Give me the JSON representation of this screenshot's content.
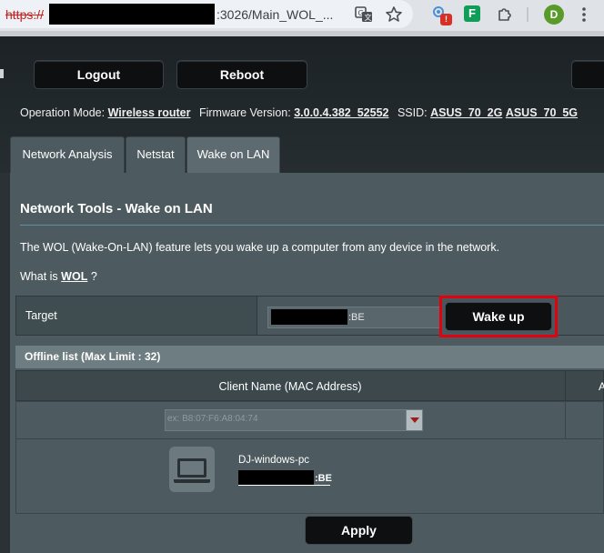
{
  "browser": {
    "url_scheme": "https://",
    "url_rest": ":3026/Main_WOL_...",
    "profile_initial": "D",
    "ext_f_letter": "F",
    "ext_badge": "!",
    "icons": [
      "translate-icon",
      "star-icon",
      "extension-badge-icon",
      "feedly-icon",
      "puzzle-icon",
      "profile-avatar",
      "kebab-menu-icon"
    ]
  },
  "header": {
    "logout_label": "Logout",
    "reboot_label": "Reboot",
    "operation_mode_label": "Operation Mode:",
    "operation_mode_value": "Wireless router",
    "firmware_label": "Firmware Version:",
    "firmware_value": "3.0.0.4.382_52552",
    "ssid_label": "SSID:",
    "ssid_2g": "ASUS_70_2G",
    "ssid_5g": "ASUS_70_5G"
  },
  "tabs": [
    {
      "label": "Network Analysis",
      "active": false
    },
    {
      "label": "Netstat",
      "active": false
    },
    {
      "label": "Wake on LAN",
      "active": true
    }
  ],
  "main": {
    "title": "Network Tools - Wake on LAN",
    "description": "The WOL (Wake-On-LAN) feature lets you wake up a computer from any device in the network.",
    "whatis_prefix": "What is",
    "whatis_link": "WOL",
    "whatis_suffix": "?",
    "target_label": "Target",
    "target_mac_suffix": ":BE",
    "wake_label": "Wake up",
    "offline_list_title": "Offline list (Max Limit : 32)",
    "client_col_header": "Client Name (MAC Address)",
    "col_header_cut": "A",
    "select_placeholder": "ex: B8:07:F6:A8:04:74",
    "client_name": "DJ-windows-pc",
    "client_mac_suffix": ":BE",
    "apply_label": "Apply"
  },
  "colors": {
    "highlight": "#e3000f",
    "panel": "#4d5a5f",
    "button": "#0d0f10"
  }
}
